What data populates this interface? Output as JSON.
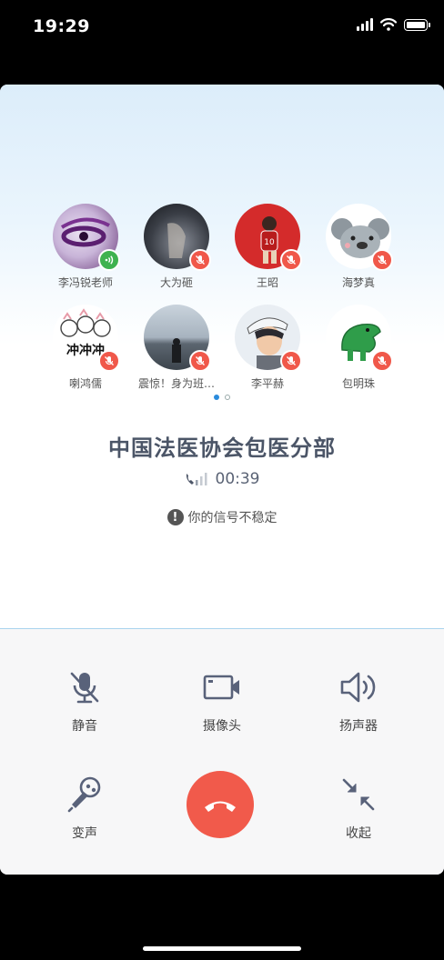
{
  "status_bar": {
    "time": "19:29"
  },
  "members": [
    {
      "name": "李冯锐老师",
      "status": "talking"
    },
    {
      "name": "大为砸",
      "status": "muted"
    },
    {
      "name": "王昭",
      "status": "muted"
    },
    {
      "name": "海梦真",
      "status": "muted"
    },
    {
      "name": "喇鸿儒",
      "status": "muted"
    },
    {
      "name": "震惊！身为班…",
      "status": "muted"
    },
    {
      "name": "李平赫",
      "status": "muted"
    },
    {
      "name": "包明珠",
      "status": "muted"
    }
  ],
  "avatar_art": {
    "member5_text": "冲冲冲"
  },
  "pagination": {
    "pages": 2,
    "current": 1
  },
  "call": {
    "group_name": "中国法医协会包医分部",
    "duration": "00:39",
    "signal_warning": "你的信号不稳定"
  },
  "controls": {
    "mute": "静音",
    "camera": "摄像头",
    "speaker": "扬声器",
    "voice_changer": "变声",
    "minimize": "收起"
  },
  "colors": {
    "hangup": "#f15a4b",
    "mute_badge": "#f0584a",
    "talk_badge": "#3fb24f",
    "page_dot_active": "#2a8bdc",
    "title_text": "#4b5567"
  }
}
